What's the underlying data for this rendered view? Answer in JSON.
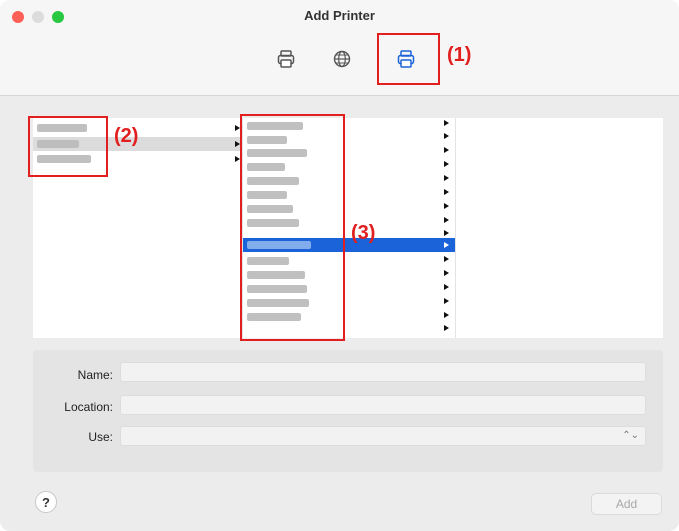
{
  "window": {
    "title": "Add Printer"
  },
  "toolbar": {
    "items": [
      {
        "icon": "printer-icon",
        "selected": false
      },
      {
        "icon": "globe-icon",
        "selected": false
      },
      {
        "icon": "printer-icon",
        "selected": true
      }
    ]
  },
  "annotations": {
    "a1": "(1)",
    "a2": "(2)",
    "a3": "(3)"
  },
  "form": {
    "name_label": "Name:",
    "location_label": "Location:",
    "use_label": "Use:",
    "name_value": "",
    "location_value": "",
    "use_value": ""
  },
  "buttons": {
    "help": "?",
    "add": "Add"
  },
  "colors": {
    "selection": "#1a63d8",
    "annotation": "#e21f1f"
  }
}
